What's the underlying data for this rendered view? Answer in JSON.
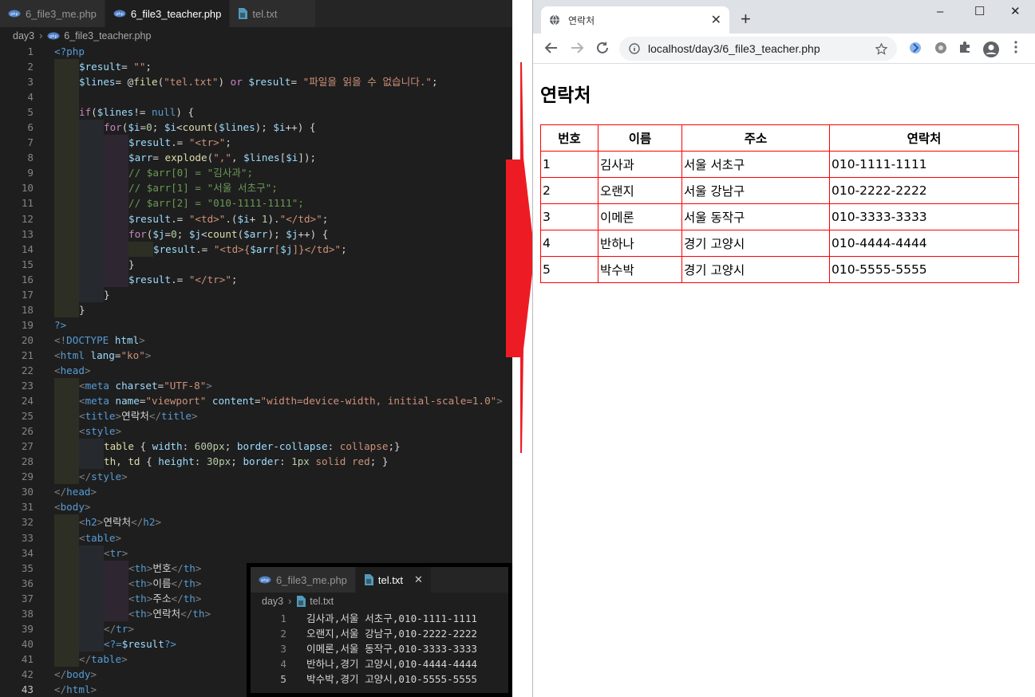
{
  "editor": {
    "tabs": [
      {
        "label": "6_file3_me.php",
        "type": "php"
      },
      {
        "label": "6_file3_teacher.php",
        "type": "php",
        "active": true
      },
      {
        "label": "tel.txt",
        "type": "txt"
      }
    ],
    "breadcrumb": {
      "folder": "day3",
      "file": "6_file3_teacher.php"
    },
    "current_line": 43,
    "code_lines": [
      {
        "n": 1,
        "i": 0,
        "t": [
          [
            "k-ph",
            "<?php"
          ]
        ]
      },
      {
        "n": 2,
        "i": 1,
        "t": [
          [
            "k-var",
            "$result"
          ],
          [
            "",
            "= "
          ],
          [
            "k-str",
            "\"\""
          ],
          [
            "",
            ";"
          ]
        ]
      },
      {
        "n": 3,
        "i": 1,
        "t": [
          [
            "k-var",
            "$lines"
          ],
          [
            "",
            "= @"
          ],
          [
            "k-fn",
            "file"
          ],
          [
            "",
            "("
          ],
          [
            "k-str",
            "\"tel.txt\""
          ],
          [
            "",
            ") "
          ],
          [
            "k-kw",
            "or"
          ],
          [
            "",
            ""
          ],
          [
            "k-var",
            " $result"
          ],
          [
            "",
            "= "
          ],
          [
            "k-str",
            "\"파일을 읽을 수 없습니다.\""
          ],
          [
            "",
            ";"
          ]
        ]
      },
      {
        "n": 4,
        "i": 1,
        "t": []
      },
      {
        "n": 5,
        "i": 1,
        "t": [
          [
            "k-kw",
            "if"
          ],
          [
            "",
            "("
          ],
          [
            "k-var",
            "$lines"
          ],
          [
            "",
            "!= "
          ],
          [
            "k-ph",
            "null"
          ],
          [
            "",
            ") {"
          ]
        ]
      },
      {
        "n": 6,
        "i": 2,
        "t": [
          [
            "k-kw",
            "for"
          ],
          [
            "",
            "("
          ],
          [
            "k-var",
            "$i"
          ],
          [
            "",
            "="
          ],
          [
            "k-num",
            "0"
          ],
          [
            "",
            "; "
          ],
          [
            "k-var",
            "$i"
          ],
          [
            "",
            "<"
          ],
          [
            "k-fn",
            "count"
          ],
          [
            "",
            "("
          ],
          [
            "k-var",
            "$lines"
          ],
          [
            "",
            "); "
          ],
          [
            "k-var",
            "$i"
          ],
          [
            "",
            "++) {"
          ]
        ]
      },
      {
        "n": 7,
        "i": 3,
        "t": [
          [
            "k-var",
            "$result"
          ],
          [
            "",
            ".= "
          ],
          [
            "k-str",
            "\"<tr>\""
          ],
          [
            "",
            ";"
          ]
        ]
      },
      {
        "n": 8,
        "i": 3,
        "t": [
          [
            "k-var",
            "$arr"
          ],
          [
            "",
            "= "
          ],
          [
            "k-fn",
            "explode"
          ],
          [
            "",
            "("
          ],
          [
            "k-str",
            "\",\""
          ],
          [
            "",
            ", "
          ],
          [
            "k-var",
            "$lines"
          ],
          [
            "",
            "["
          ],
          [
            "k-var",
            "$i"
          ],
          [
            "",
            "]);"
          ]
        ]
      },
      {
        "n": 9,
        "i": 3,
        "t": [
          [
            "k-com",
            "// $arr[0] = \"김사과\";"
          ]
        ]
      },
      {
        "n": 10,
        "i": 3,
        "t": [
          [
            "k-com",
            "// $arr[1] = \"서울 서초구\";"
          ]
        ]
      },
      {
        "n": 11,
        "i": 3,
        "t": [
          [
            "k-com",
            "// $arr[2] = \"010-1111-1111\";"
          ]
        ]
      },
      {
        "n": 12,
        "i": 3,
        "t": [
          [
            "k-var",
            "$result"
          ],
          [
            "",
            ".= "
          ],
          [
            "k-str",
            "\"<td>\""
          ],
          [
            "",
            ".("
          ],
          [
            "k-var",
            "$i"
          ],
          [
            "",
            "+ "
          ],
          [
            "k-num",
            "1"
          ],
          [
            "",
            ")."
          ],
          [
            "k-str",
            "\"</td>\""
          ],
          [
            "",
            ";"
          ]
        ]
      },
      {
        "n": 13,
        "i": 3,
        "t": [
          [
            "k-kw",
            "for"
          ],
          [
            "",
            "("
          ],
          [
            "k-var",
            "$j"
          ],
          [
            "",
            "="
          ],
          [
            "k-num",
            "0"
          ],
          [
            "",
            "; "
          ],
          [
            "k-var",
            "$j"
          ],
          [
            "",
            "<"
          ],
          [
            "k-fn",
            "count"
          ],
          [
            "",
            "("
          ],
          [
            "k-var",
            "$arr"
          ],
          [
            "",
            "); "
          ],
          [
            "k-var",
            "$j"
          ],
          [
            "",
            "++) {"
          ]
        ]
      },
      {
        "n": 14,
        "i": 4,
        "t": [
          [
            "k-var",
            "$result"
          ],
          [
            "",
            ".= "
          ],
          [
            "k-str",
            "\"<td>{"
          ],
          [
            "k-var",
            "$arr"
          ],
          [
            "k-str",
            "["
          ],
          [
            "k-var",
            "$j"
          ],
          [
            "k-str",
            "]}</td>\""
          ],
          [
            "",
            ";"
          ]
        ]
      },
      {
        "n": 15,
        "i": 3,
        "t": [
          [
            "",
            "}"
          ]
        ]
      },
      {
        "n": 16,
        "i": 3,
        "t": [
          [
            "k-var",
            "$result"
          ],
          [
            "",
            ".= "
          ],
          [
            "k-str",
            "\"</tr>\""
          ],
          [
            "",
            ";"
          ]
        ]
      },
      {
        "n": 17,
        "i": 2,
        "t": [
          [
            "",
            "}"
          ]
        ]
      },
      {
        "n": 18,
        "i": 1,
        "t": [
          [
            "",
            "}"
          ]
        ]
      },
      {
        "n": 19,
        "i": 0,
        "t": [
          [
            "k-ph",
            "?>"
          ]
        ]
      },
      {
        "n": 20,
        "i": 0,
        "t": [
          [
            "k-br",
            "<!"
          ],
          [
            "k-tag",
            "DOCTYPE"
          ],
          [
            "k-attr",
            " html"
          ],
          [
            "k-br",
            ">"
          ]
        ]
      },
      {
        "n": 21,
        "i": 0,
        "t": [
          [
            "k-br",
            "<"
          ],
          [
            "k-tag",
            "html"
          ],
          [
            "k-attr",
            " lang"
          ],
          [
            "",
            "="
          ],
          [
            "k-str",
            "\"ko\""
          ],
          [
            "k-br",
            ">"
          ]
        ]
      },
      {
        "n": 22,
        "i": 0,
        "t": [
          [
            "k-br",
            "<"
          ],
          [
            "k-tag",
            "head"
          ],
          [
            "k-br",
            ">"
          ]
        ]
      },
      {
        "n": 23,
        "i": 1,
        "t": [
          [
            "k-br",
            "<"
          ],
          [
            "k-tag",
            "meta"
          ],
          [
            "k-attr",
            " charset"
          ],
          [
            "",
            "="
          ],
          [
            "k-str",
            "\"UTF-8\""
          ],
          [
            "k-br",
            ">"
          ]
        ]
      },
      {
        "n": 24,
        "i": 1,
        "t": [
          [
            "k-br",
            "<"
          ],
          [
            "k-tag",
            "meta"
          ],
          [
            "k-attr",
            " name"
          ],
          [
            "",
            "="
          ],
          [
            "k-str",
            "\"viewport\""
          ],
          [
            "k-attr",
            " content"
          ],
          [
            "",
            "="
          ],
          [
            "k-str",
            "\"width=device-width, initial-scale=1.0\""
          ],
          [
            "k-br",
            ">"
          ]
        ]
      },
      {
        "n": 25,
        "i": 1,
        "t": [
          [
            "k-br",
            "<"
          ],
          [
            "k-tag",
            "title"
          ],
          [
            "k-br",
            ">"
          ],
          [
            "",
            "연락처"
          ],
          [
            "k-br",
            "</"
          ],
          [
            "k-tag",
            "title"
          ],
          [
            "k-br",
            ">"
          ]
        ]
      },
      {
        "n": 26,
        "i": 1,
        "t": [
          [
            "k-br",
            "<"
          ],
          [
            "k-tag",
            "style"
          ],
          [
            "k-br",
            ">"
          ]
        ]
      },
      {
        "n": 27,
        "i": 2,
        "t": [
          [
            "k-fn",
            "table"
          ],
          [
            "",
            " { "
          ],
          [
            "k-attr",
            "width"
          ],
          [
            "",
            ": "
          ],
          [
            "k-num",
            "600px"
          ],
          [
            "",
            "; "
          ],
          [
            "k-attr",
            "border-collapse"
          ],
          [
            "",
            ": "
          ],
          [
            "k-str",
            "collapse"
          ],
          [
            "",
            ";}"
          ]
        ]
      },
      {
        "n": 28,
        "i": 2,
        "t": [
          [
            "k-fn",
            "th"
          ],
          [
            "",
            ", "
          ],
          [
            "k-fn",
            "td"
          ],
          [
            "",
            " { "
          ],
          [
            "k-attr",
            "height"
          ],
          [
            "",
            ": "
          ],
          [
            "k-num",
            "30px"
          ],
          [
            "",
            "; "
          ],
          [
            "k-attr",
            "border"
          ],
          [
            "",
            ": "
          ],
          [
            "k-num",
            "1px"
          ],
          [
            "k-str",
            " solid"
          ],
          [
            "k-str",
            " red"
          ],
          [
            "",
            "; }"
          ]
        ]
      },
      {
        "n": 29,
        "i": 1,
        "t": [
          [
            "k-br",
            "</"
          ],
          [
            "k-tag",
            "style"
          ],
          [
            "k-br",
            ">"
          ]
        ]
      },
      {
        "n": 30,
        "i": 0,
        "t": [
          [
            "k-br",
            "</"
          ],
          [
            "k-tag",
            "head"
          ],
          [
            "k-br",
            ">"
          ]
        ]
      },
      {
        "n": 31,
        "i": 0,
        "t": [
          [
            "k-br",
            "<"
          ],
          [
            "k-tag",
            "body"
          ],
          [
            "k-br",
            ">"
          ]
        ]
      },
      {
        "n": 32,
        "i": 1,
        "t": [
          [
            "k-br",
            "<"
          ],
          [
            "k-tag",
            "h2"
          ],
          [
            "k-br",
            ">"
          ],
          [
            "",
            "연락처"
          ],
          [
            "k-br",
            "</"
          ],
          [
            "k-tag",
            "h2"
          ],
          [
            "k-br",
            ">"
          ]
        ]
      },
      {
        "n": 33,
        "i": 1,
        "t": [
          [
            "k-br",
            "<"
          ],
          [
            "k-tag",
            "table"
          ],
          [
            "k-br",
            ">"
          ]
        ]
      },
      {
        "n": 34,
        "i": 2,
        "t": [
          [
            "k-br",
            "<"
          ],
          [
            "k-tag",
            "tr"
          ],
          [
            "k-br",
            ">"
          ]
        ]
      },
      {
        "n": 35,
        "i": 3,
        "t": [
          [
            "k-br",
            "<"
          ],
          [
            "k-tag",
            "th"
          ],
          [
            "k-br",
            ">"
          ],
          [
            "",
            "번호"
          ],
          [
            "k-br",
            "</"
          ],
          [
            "k-tag",
            "th"
          ],
          [
            "k-br",
            ">"
          ]
        ]
      },
      {
        "n": 36,
        "i": 3,
        "t": [
          [
            "k-br",
            "<"
          ],
          [
            "k-tag",
            "th"
          ],
          [
            "k-br",
            ">"
          ],
          [
            "",
            "이름"
          ],
          [
            "k-br",
            "</"
          ],
          [
            "k-tag",
            "th"
          ],
          [
            "k-br",
            ">"
          ]
        ]
      },
      {
        "n": 37,
        "i": 3,
        "t": [
          [
            "k-br",
            "<"
          ],
          [
            "k-tag",
            "th"
          ],
          [
            "k-br",
            ">"
          ],
          [
            "",
            "주소"
          ],
          [
            "k-br",
            "</"
          ],
          [
            "k-tag",
            "th"
          ],
          [
            "k-br",
            ">"
          ]
        ]
      },
      {
        "n": 38,
        "i": 3,
        "t": [
          [
            "k-br",
            "<"
          ],
          [
            "k-tag",
            "th"
          ],
          [
            "k-br",
            ">"
          ],
          [
            "",
            "연락처"
          ],
          [
            "k-br",
            "</"
          ],
          [
            "k-tag",
            "th"
          ],
          [
            "k-br",
            ">"
          ]
        ]
      },
      {
        "n": 39,
        "i": 2,
        "t": [
          [
            "k-br",
            "</"
          ],
          [
            "k-tag",
            "tr"
          ],
          [
            "k-br",
            ">"
          ]
        ]
      },
      {
        "n": 40,
        "i": 2,
        "t": [
          [
            "k-ph",
            "<?="
          ],
          [
            "k-var",
            "$result"
          ],
          [
            "k-ph",
            "?>"
          ]
        ]
      },
      {
        "n": 41,
        "i": 1,
        "t": [
          [
            "k-br",
            "</"
          ],
          [
            "k-tag",
            "table"
          ],
          [
            "k-br",
            ">"
          ]
        ]
      },
      {
        "n": 42,
        "i": 0,
        "t": [
          [
            "k-br",
            "</"
          ],
          [
            "k-tag",
            "body"
          ],
          [
            "k-br",
            ">"
          ]
        ]
      },
      {
        "n": 43,
        "i": 0,
        "t": [
          [
            "k-br",
            "</"
          ],
          [
            "k-tag",
            "html"
          ],
          [
            "k-br",
            ">"
          ]
        ]
      }
    ]
  },
  "tel_panel": {
    "tabs": [
      {
        "label": "6_file3_me.php",
        "type": "php"
      },
      {
        "label": "tel.txt",
        "type": "txt",
        "active": true
      }
    ],
    "breadcrumb": {
      "folder": "day3",
      "file": "tel.txt"
    },
    "lines": [
      "김사과,서울 서초구,010-1111-1111",
      "오랜지,서울 강남구,010-2222-2222",
      "이메론,서울 동작구,010-3333-3333",
      "반하나,경기 고양시,010-4444-4444",
      "박수박,경기 고양시,010-5555-5555"
    ]
  },
  "browser": {
    "tab_title": "연락처",
    "url": "localhost/day3/6_file3_teacher.php",
    "page": {
      "heading": "연락처",
      "columns": [
        "번호",
        "이름",
        "주소",
        "연락처"
      ],
      "rows": [
        [
          "1",
          "김사과",
          "서울 서초구",
          "010-1111-1111"
        ],
        [
          "2",
          "오랜지",
          "서울 강남구",
          "010-2222-2222"
        ],
        [
          "3",
          "이메론",
          "서울 동작구",
          "010-3333-3333"
        ],
        [
          "4",
          "반하나",
          "경기 고양시",
          "010-4444-4444"
        ],
        [
          "5",
          "박수박",
          "경기 고양시",
          "010-5555-5555"
        ]
      ]
    }
  },
  "colors": {
    "arrow": "#ed1c24",
    "table_border": "#ff0000",
    "editor_bg": "#1e1e1e"
  }
}
